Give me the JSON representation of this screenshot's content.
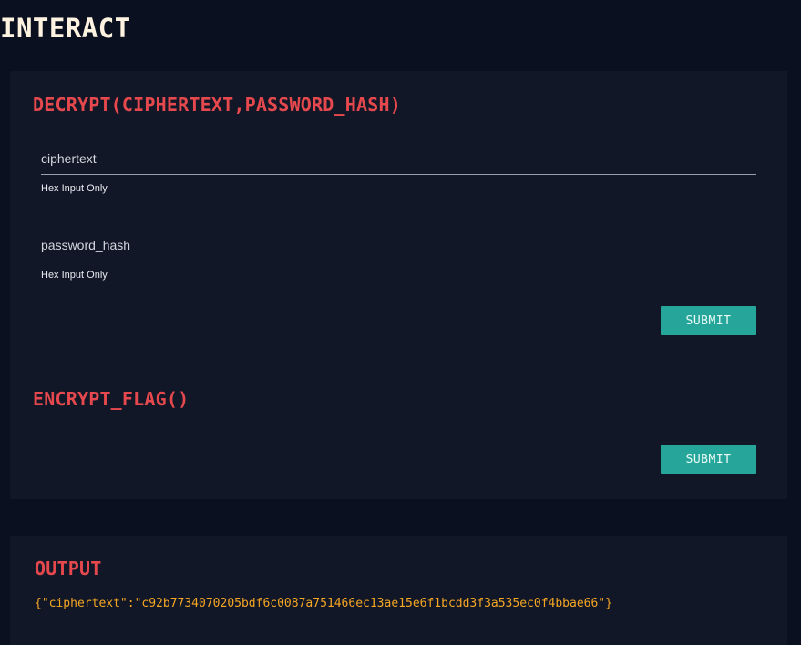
{
  "page": {
    "title": "INTERACT"
  },
  "decrypt": {
    "title": "DECRYPT(CIPHERTEXT,PASSWORD_HASH)",
    "fields": [
      {
        "placeholder": "ciphertext",
        "value": "",
        "helper": "Hex Input Only"
      },
      {
        "placeholder": "password_hash",
        "value": "",
        "helper": "Hex Input Only"
      }
    ],
    "submit_label": "SUBMIT"
  },
  "encrypt_flag": {
    "title": "ENCRYPT_FLAG()",
    "submit_label": "SUBMIT"
  },
  "output": {
    "title": "OUTPUT",
    "text": "{\"ciphertext\":\"c92b7734070205bdf6c0087a751466ec13ae15e6f1bcdd3f3a535ec0f4bbae66\"}"
  },
  "colors": {
    "background": "#0b1020",
    "card": "#111726",
    "accent_red": "#e5484d",
    "button_teal": "#26a69a",
    "output_orange": "#f5a623"
  }
}
